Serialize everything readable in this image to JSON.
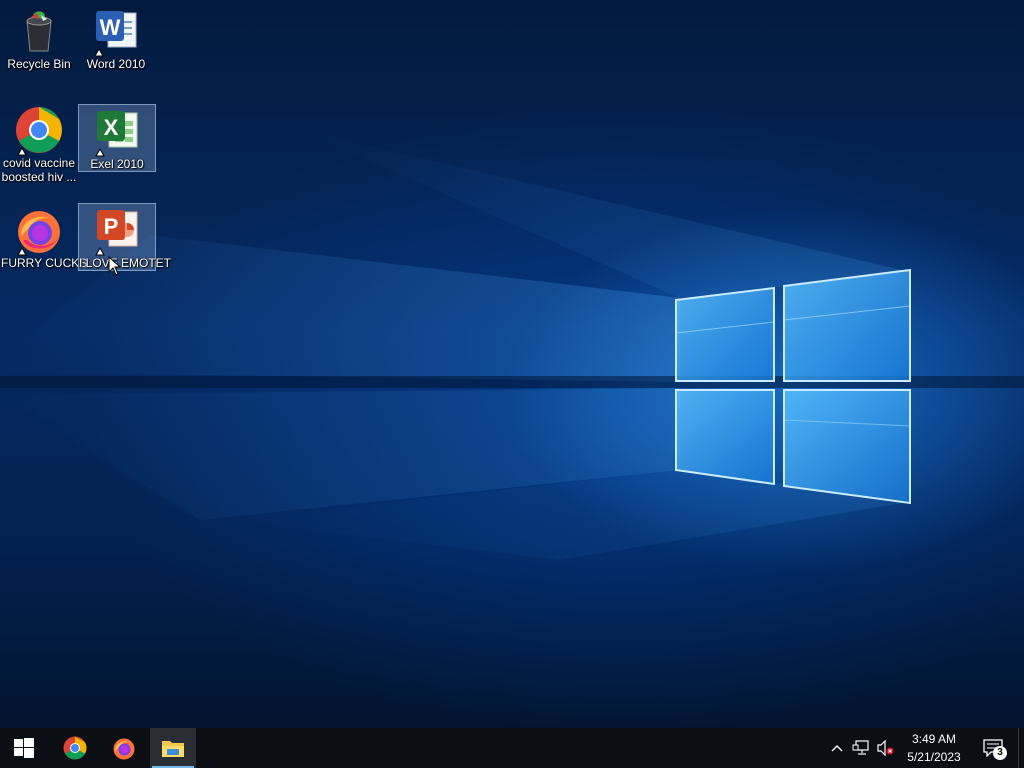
{
  "desktop": {
    "icons": [
      {
        "id": "recycle-bin",
        "label": "Recycle Bin",
        "label2": "",
        "icon": "recycle-bin-icon",
        "selected": false
      },
      {
        "id": "word",
        "label": "Word 2010",
        "label2": "",
        "icon": "word-icon",
        "selected": false
      },
      {
        "id": "chrome",
        "label": "covid vaccine",
        "label2": "boosted hiv ...",
        "icon": "chrome-icon",
        "selected": false
      },
      {
        "id": "excel",
        "label": "Exel 2010",
        "label2": "",
        "icon": "excel-icon",
        "selected": true
      },
      {
        "id": "firefox",
        "label": "FURRY CUCKS",
        "label2": "",
        "icon": "firefox-icon",
        "selected": false
      },
      {
        "id": "powerpoint",
        "label": "I LOVE EMOTET",
        "label2": "",
        "icon": "powerpoint-icon",
        "selected": true
      }
    ]
  },
  "taskbar": {
    "start": {
      "icon": "windows-start-icon"
    },
    "pinned": [
      {
        "name": "chrome",
        "icon": "chrome-icon",
        "active": false
      },
      {
        "name": "firefox",
        "icon": "firefox-icon",
        "active": false
      },
      {
        "name": "file-explorer",
        "icon": "folder-icon",
        "active": true
      }
    ],
    "tray": {
      "icons": [
        "chevron-up-icon",
        "network-icon",
        "volume-muted-icon"
      ],
      "time": "3:49 AM",
      "date": "5/21/2023",
      "notification_count": "3"
    }
  },
  "colors": {
    "taskbar_bg": "#0b0e14",
    "accent": "#76b9ed",
    "wallpaper_dark": "#031a3d",
    "wallpaper_glow": "#2896ff"
  }
}
